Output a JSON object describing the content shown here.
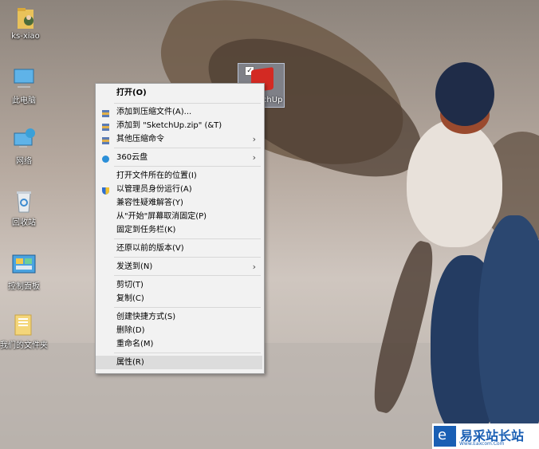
{
  "desktop_icons": [
    {
      "label": "ks-xiao",
      "icon": "user-folder-icon"
    },
    {
      "label": "此电脑",
      "icon": "computer-icon"
    },
    {
      "label": "网络",
      "icon": "network-icon"
    },
    {
      "label": "回收站",
      "icon": "recycle-bin-icon"
    },
    {
      "label": "控制面板",
      "icon": "control-panel-icon"
    },
    {
      "label": "我们的文件夹",
      "icon": "folder-icon"
    }
  ],
  "selected_icon": {
    "label": "tchUp",
    "icon": "sketchup-icon"
  },
  "menu": {
    "items": [
      {
        "label": "打开(O)",
        "bold": true
      },
      {
        "label": "添加到压缩文件(A)...",
        "icon": "archive-icon"
      },
      {
        "label": "添加到 \"SketchUp.zip\" (&T)",
        "icon": "archive-icon"
      },
      {
        "label": "其他压缩命令",
        "icon": "archive-icon",
        "submenu": true
      },
      {
        "label": "360云盘",
        "icon": "cloud-icon",
        "submenu": true
      },
      {
        "label": "打开文件所在的位置(I)"
      },
      {
        "label": "以管理员身份运行(A)",
        "icon": "shield-icon"
      },
      {
        "label": "兼容性疑难解答(Y)"
      },
      {
        "label": "从\"开始\"屏幕取消固定(P)"
      },
      {
        "label": "固定到任务栏(K)"
      },
      {
        "label": "还原以前的版本(V)"
      },
      {
        "label": "发送到(N)",
        "submenu": true
      },
      {
        "label": "剪切(T)"
      },
      {
        "label": "复制(C)"
      },
      {
        "label": "创建快捷方式(S)"
      },
      {
        "label": "删除(D)"
      },
      {
        "label": "重命名(M)"
      },
      {
        "label": "属性(R)",
        "highlighted": true
      }
    ],
    "submenu_arrow": "›"
  },
  "watermark": {
    "name": "易采站长站",
    "url": "Www.Eaxcom.Com"
  }
}
